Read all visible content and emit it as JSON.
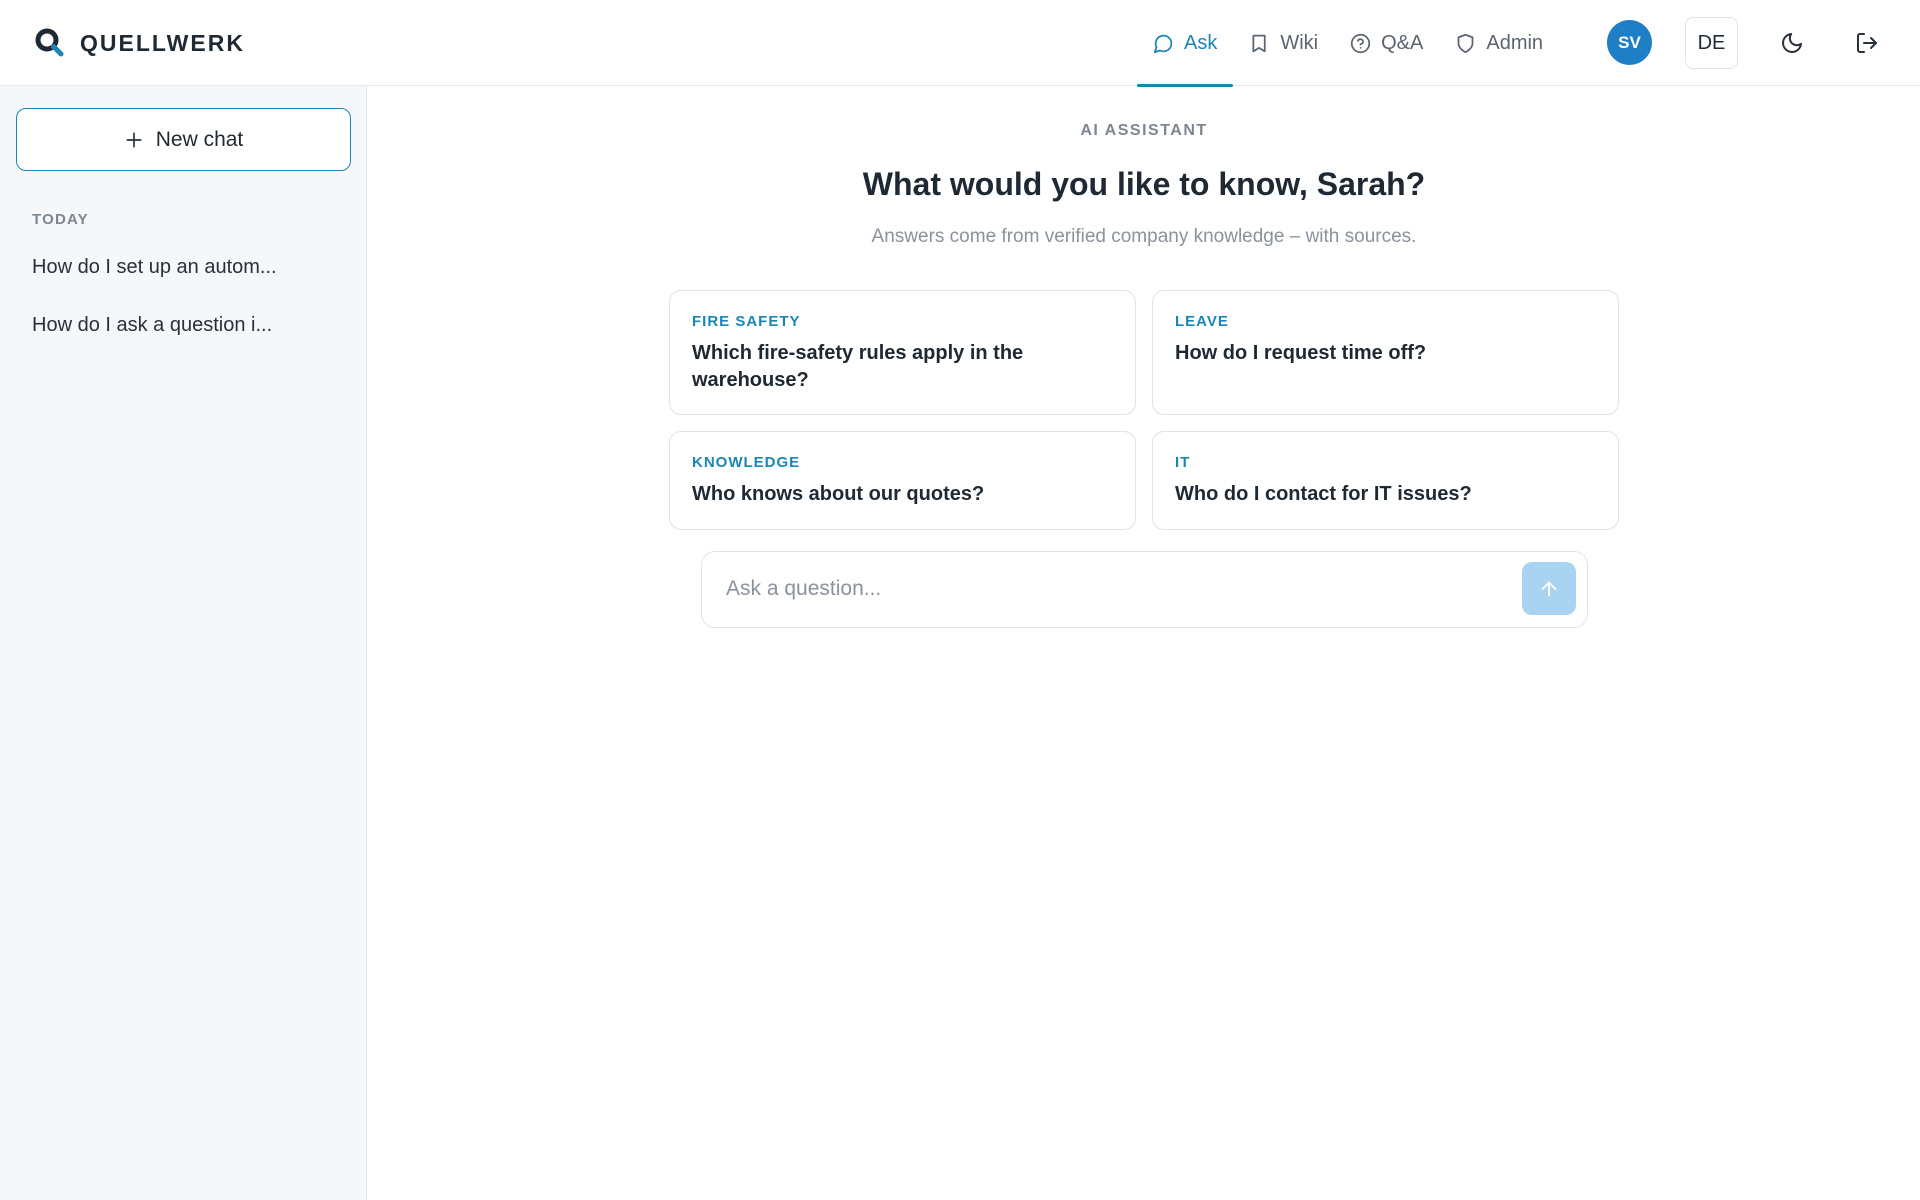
{
  "app": {
    "name": "QUELLWERK"
  },
  "nav": {
    "tabs": [
      {
        "label": "Ask",
        "icon": "chat-bubble-icon",
        "active": true
      },
      {
        "label": "Wiki",
        "icon": "book-icon",
        "active": false
      },
      {
        "label": "Q&A",
        "icon": "question-circle-icon",
        "active": false
      },
      {
        "label": "Admin",
        "icon": "shield-icon",
        "active": false
      }
    ]
  },
  "user": {
    "initials": "SV",
    "language": "DE"
  },
  "sidebar": {
    "new_chat_label": "New chat",
    "section_label": "TODAY",
    "history": [
      {
        "title": "How do I set up an autom..."
      },
      {
        "title": "How do I ask a question i..."
      }
    ]
  },
  "main": {
    "eyebrow": "AI ASSISTANT",
    "title": "What would you like to know, Sarah?",
    "subtitle": "Answers come from verified company knowledge – with sources.",
    "suggestions": [
      {
        "category": "FIRE SAFETY",
        "question": "Which fire-safety rules apply in the warehouse?"
      },
      {
        "category": "LEAVE",
        "question": "How do I request time off?"
      },
      {
        "category": "KNOWLEDGE",
        "question": "Who knows about our quotes?"
      },
      {
        "category": "IT",
        "question": "Who do I contact for IT issues?"
      }
    ],
    "ask": {
      "placeholder": "Ask a question...",
      "value": ""
    }
  },
  "colors": {
    "accent": "#1b86b5",
    "avatar": "#1e7fc6",
    "send_button": "#a9d3f0",
    "sidebar_bg": "#f5f7fa"
  }
}
